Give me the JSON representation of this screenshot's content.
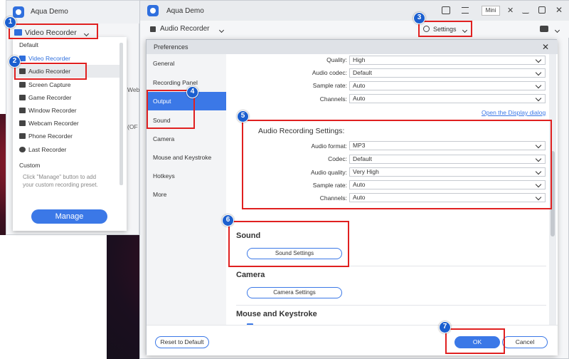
{
  "left_window": {
    "title": "Aqua Demo",
    "recorder_label": "Video Recorder",
    "menu": {
      "default_label": "Default",
      "items": [
        {
          "label": "Video Recorder",
          "icon": "video-icon"
        },
        {
          "label": "Audio Recorder",
          "icon": "speaker-icon"
        },
        {
          "label": "Screen Capture",
          "icon": "camera-icon"
        },
        {
          "label": "Game Recorder",
          "icon": "gamepad-icon"
        },
        {
          "label": "Window Recorder",
          "icon": "window-icon"
        },
        {
          "label": "Webcam Recorder",
          "icon": "webcam-icon"
        },
        {
          "label": "Phone Recorder",
          "icon": "phone-icon"
        },
        {
          "label": "Last Recorder",
          "icon": "clock-icon"
        }
      ],
      "custom_label": "Custom",
      "custom_hint": "Click \"Manage\" button to add your custom recording preset.",
      "manage_label": "Manage"
    },
    "peek_text": "Web",
    "peek_text2": "(OF"
  },
  "main_window": {
    "title": "Aqua Demo",
    "mini_label": "Mini",
    "recorder_label": "Audio Recorder",
    "settings_label": "Settings"
  },
  "preferences": {
    "title": "Preferences",
    "sidebar": [
      {
        "label": "General"
      },
      {
        "label": "Recording Panel"
      },
      {
        "label": "Output"
      },
      {
        "label": "Sound"
      },
      {
        "label": "Camera"
      },
      {
        "label": "Mouse and Keystroke"
      },
      {
        "label": "Hotkeys"
      },
      {
        "label": "More"
      }
    ],
    "video_settings": [
      {
        "label": "Quality:",
        "value": "High"
      },
      {
        "label": "Audio codec:",
        "value": "Default"
      },
      {
        "label": "Sample rate:",
        "value": "Auto"
      },
      {
        "label": "Channels:",
        "value": "Auto"
      }
    ],
    "display_link": "Open the Display dialog",
    "audio_heading": "Audio Recording Settings:",
    "audio_settings": [
      {
        "label": "Audio format:",
        "value": "MP3"
      },
      {
        "label": "Codec:",
        "value": "Default"
      },
      {
        "label": "Audio quality:",
        "value": "Very High"
      },
      {
        "label": "Sample rate:",
        "value": "Auto"
      },
      {
        "label": "Channels:",
        "value": "Auto"
      }
    ],
    "sound_heading": "Sound",
    "sound_button": "Sound Settings",
    "camera_heading": "Camera",
    "camera_button": "Camera Settings",
    "mouse_heading": "Mouse and Keystroke",
    "reset_label": "Reset to Default",
    "ok_label": "OK",
    "cancel_label": "Cancel"
  },
  "badges": [
    "1",
    "2",
    "3",
    "4",
    "5",
    "6",
    "7"
  ],
  "colors": {
    "accent": "#3b78e7",
    "highlight": "#e02020",
    "badge": "#1b5fcf"
  }
}
